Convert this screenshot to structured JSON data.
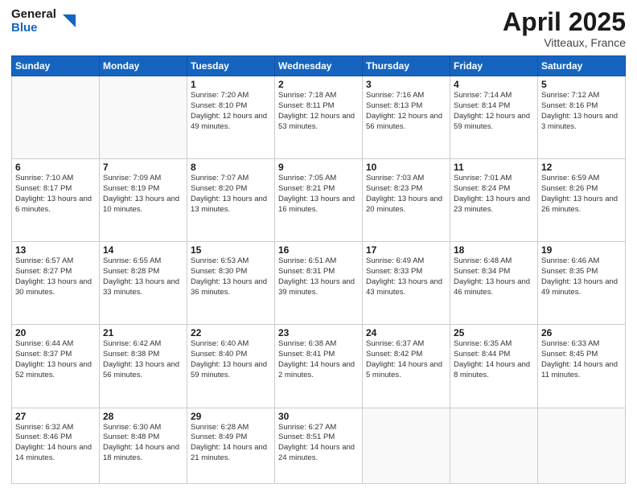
{
  "header": {
    "logo_general": "General",
    "logo_blue": "Blue",
    "month_title": "April 2025",
    "location": "Vitteaux, France"
  },
  "weekdays": [
    "Sunday",
    "Monday",
    "Tuesday",
    "Wednesday",
    "Thursday",
    "Friday",
    "Saturday"
  ],
  "weeks": [
    [
      {
        "day": "",
        "info": ""
      },
      {
        "day": "",
        "info": ""
      },
      {
        "day": "1",
        "info": "Sunrise: 7:20 AM\nSunset: 8:10 PM\nDaylight: 12 hours and 49 minutes."
      },
      {
        "day": "2",
        "info": "Sunrise: 7:18 AM\nSunset: 8:11 PM\nDaylight: 12 hours and 53 minutes."
      },
      {
        "day": "3",
        "info": "Sunrise: 7:16 AM\nSunset: 8:13 PM\nDaylight: 12 hours and 56 minutes."
      },
      {
        "day": "4",
        "info": "Sunrise: 7:14 AM\nSunset: 8:14 PM\nDaylight: 12 hours and 59 minutes."
      },
      {
        "day": "5",
        "info": "Sunrise: 7:12 AM\nSunset: 8:16 PM\nDaylight: 13 hours and 3 minutes."
      }
    ],
    [
      {
        "day": "6",
        "info": "Sunrise: 7:10 AM\nSunset: 8:17 PM\nDaylight: 13 hours and 6 minutes."
      },
      {
        "day": "7",
        "info": "Sunrise: 7:09 AM\nSunset: 8:19 PM\nDaylight: 13 hours and 10 minutes."
      },
      {
        "day": "8",
        "info": "Sunrise: 7:07 AM\nSunset: 8:20 PM\nDaylight: 13 hours and 13 minutes."
      },
      {
        "day": "9",
        "info": "Sunrise: 7:05 AM\nSunset: 8:21 PM\nDaylight: 13 hours and 16 minutes."
      },
      {
        "day": "10",
        "info": "Sunrise: 7:03 AM\nSunset: 8:23 PM\nDaylight: 13 hours and 20 minutes."
      },
      {
        "day": "11",
        "info": "Sunrise: 7:01 AM\nSunset: 8:24 PM\nDaylight: 13 hours and 23 minutes."
      },
      {
        "day": "12",
        "info": "Sunrise: 6:59 AM\nSunset: 8:26 PM\nDaylight: 13 hours and 26 minutes."
      }
    ],
    [
      {
        "day": "13",
        "info": "Sunrise: 6:57 AM\nSunset: 8:27 PM\nDaylight: 13 hours and 30 minutes."
      },
      {
        "day": "14",
        "info": "Sunrise: 6:55 AM\nSunset: 8:28 PM\nDaylight: 13 hours and 33 minutes."
      },
      {
        "day": "15",
        "info": "Sunrise: 6:53 AM\nSunset: 8:30 PM\nDaylight: 13 hours and 36 minutes."
      },
      {
        "day": "16",
        "info": "Sunrise: 6:51 AM\nSunset: 8:31 PM\nDaylight: 13 hours and 39 minutes."
      },
      {
        "day": "17",
        "info": "Sunrise: 6:49 AM\nSunset: 8:33 PM\nDaylight: 13 hours and 43 minutes."
      },
      {
        "day": "18",
        "info": "Sunrise: 6:48 AM\nSunset: 8:34 PM\nDaylight: 13 hours and 46 minutes."
      },
      {
        "day": "19",
        "info": "Sunrise: 6:46 AM\nSunset: 8:35 PM\nDaylight: 13 hours and 49 minutes."
      }
    ],
    [
      {
        "day": "20",
        "info": "Sunrise: 6:44 AM\nSunset: 8:37 PM\nDaylight: 13 hours and 52 minutes."
      },
      {
        "day": "21",
        "info": "Sunrise: 6:42 AM\nSunset: 8:38 PM\nDaylight: 13 hours and 56 minutes."
      },
      {
        "day": "22",
        "info": "Sunrise: 6:40 AM\nSunset: 8:40 PM\nDaylight: 13 hours and 59 minutes."
      },
      {
        "day": "23",
        "info": "Sunrise: 6:38 AM\nSunset: 8:41 PM\nDaylight: 14 hours and 2 minutes."
      },
      {
        "day": "24",
        "info": "Sunrise: 6:37 AM\nSunset: 8:42 PM\nDaylight: 14 hours and 5 minutes."
      },
      {
        "day": "25",
        "info": "Sunrise: 6:35 AM\nSunset: 8:44 PM\nDaylight: 14 hours and 8 minutes."
      },
      {
        "day": "26",
        "info": "Sunrise: 6:33 AM\nSunset: 8:45 PM\nDaylight: 14 hours and 11 minutes."
      }
    ],
    [
      {
        "day": "27",
        "info": "Sunrise: 6:32 AM\nSunset: 8:46 PM\nDaylight: 14 hours and 14 minutes."
      },
      {
        "day": "28",
        "info": "Sunrise: 6:30 AM\nSunset: 8:48 PM\nDaylight: 14 hours and 18 minutes."
      },
      {
        "day": "29",
        "info": "Sunrise: 6:28 AM\nSunset: 8:49 PM\nDaylight: 14 hours and 21 minutes."
      },
      {
        "day": "30",
        "info": "Sunrise: 6:27 AM\nSunset: 8:51 PM\nDaylight: 14 hours and 24 minutes."
      },
      {
        "day": "",
        "info": ""
      },
      {
        "day": "",
        "info": ""
      },
      {
        "day": "",
        "info": ""
      }
    ]
  ]
}
